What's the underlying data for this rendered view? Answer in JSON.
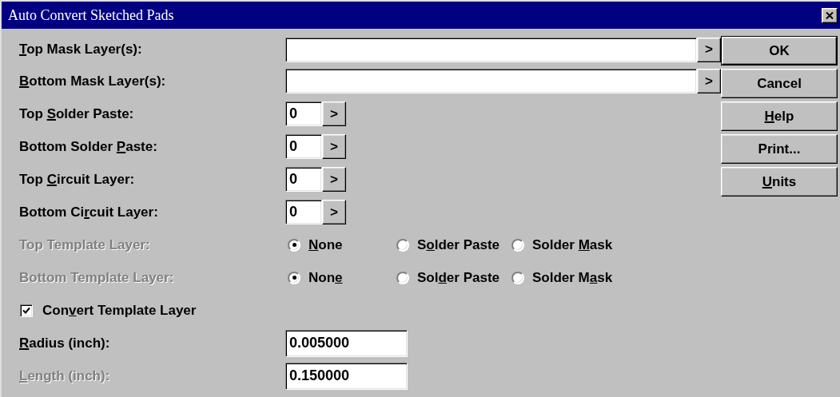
{
  "window": {
    "title": "Auto Convert Sketched Pads"
  },
  "fields": [
    {
      "kind": "wide",
      "key": "T",
      "post": "op Mask Layer(s):",
      "browse": ">"
    },
    {
      "kind": "wide",
      "key": "B",
      "post": "ottom Mask Layer(s):",
      "browse": ">"
    },
    {
      "kind": "narrow",
      "pre": "Top ",
      "key": "S",
      "post": "older Paste:",
      "value": "0",
      "browse": ">"
    },
    {
      "kind": "narrow",
      "pre": "Bottom Solder ",
      "key": "P",
      "post": "aste:",
      "value": "0",
      "browse": ">"
    },
    {
      "kind": "narrow",
      "pre": "Top ",
      "key": "C",
      "post": "ircuit Layer:",
      "value": "0",
      "browse": ">"
    },
    {
      "kind": "narrow",
      "pre": "Bottom Ci",
      "key": "r",
      "post": "cuit Layer:",
      "value": "0",
      "browse": ">"
    }
  ],
  "template_layers": [
    {
      "label": {
        "pre": "Top Template Layer:"
      },
      "disabled": true,
      "options": [
        {
          "key": "N",
          "post": "one",
          "selected": true
        },
        {
          "pre": "S",
          "key": "o",
          "post": "lder Paste",
          "selected": false
        },
        {
          "pre": "Solder ",
          "key": "M",
          "post": "ask",
          "selected": false
        }
      ]
    },
    {
      "label": {
        "pre": "Bottom Template Layer:"
      },
      "disabled": true,
      "options": [
        {
          "pre": "Non",
          "key": "e",
          "selected": true
        },
        {
          "pre": "Sol",
          "key": "d",
          "post": "er Paste",
          "selected": false
        },
        {
          "pre": "Solder M",
          "key": "a",
          "post": "sk",
          "selected": false
        }
      ]
    }
  ],
  "convert_template": {
    "pre": "Con",
    "key": "v",
    "post": "ert Template Layer",
    "checked": true
  },
  "measurements": [
    {
      "key": "R",
      "post": "adius (inch):",
      "value": "0.005000",
      "disabled": false
    },
    {
      "key": "L",
      "post": "ength (inch):",
      "value": "0.150000",
      "disabled": true
    }
  ],
  "buttons": [
    {
      "pre": "OK",
      "default": true
    },
    {
      "pre": "Cancel",
      "default": false
    },
    {
      "key": "H",
      "post": "elp",
      "default": false
    },
    {
      "pre": "Print...",
      "default": false
    },
    {
      "key": "U",
      "post": "nits",
      "default": false
    }
  ]
}
